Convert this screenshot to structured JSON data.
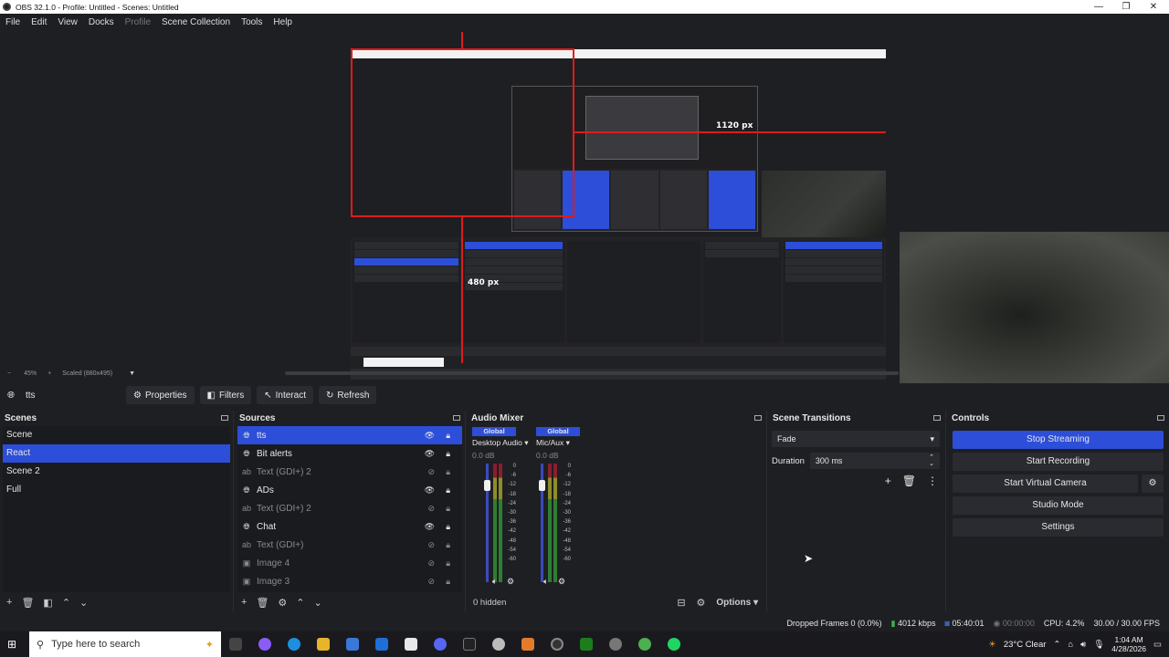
{
  "window": {
    "title": "OBS 32.1.0 - Profile: Untitled - Scenes: Untitled",
    "minimize": "—",
    "restore": "❐",
    "close": "✕"
  },
  "menu": [
    "File",
    "Edit",
    "View",
    "Docks",
    "Profile",
    "Scene Collection",
    "Tools",
    "Help"
  ],
  "preview": {
    "width_label": "1120 px",
    "height_label": "480 px",
    "zoom": "45%",
    "scale_mode": "Scaled (880x495)"
  },
  "source_toolbar": {
    "selected_source": "tts",
    "properties": "Properties",
    "filters": "Filters",
    "interact": "Interact",
    "refresh": "Refresh"
  },
  "scenes": {
    "title": "Scenes",
    "items": [
      "Scene",
      "React",
      "Scene 2",
      "Full"
    ],
    "active": "React"
  },
  "sources": {
    "title": "Sources",
    "items": [
      {
        "name": "tts",
        "icon": "browser-icon",
        "visible": true
      },
      {
        "name": "Bit alerts",
        "icon": "browser-icon",
        "visible": true
      },
      {
        "name": "Text (GDI+) 2",
        "icon": "text-icon",
        "visible": false
      },
      {
        "name": "ADs",
        "icon": "browser-icon",
        "visible": true
      },
      {
        "name": "Text (GDI+) 2",
        "icon": "text-icon",
        "visible": false
      },
      {
        "name": "Chat",
        "icon": "browser-icon",
        "visible": true
      },
      {
        "name": "Text (GDI+)",
        "icon": "text-icon",
        "visible": false
      },
      {
        "name": "Image 4",
        "icon": "image-icon",
        "visible": false
      },
      {
        "name": "Image 3",
        "icon": "image-icon",
        "visible": false
      }
    ]
  },
  "mixer": {
    "title": "Audio Mixer",
    "channels": [
      {
        "scope": "Global",
        "name": "Desktop Audio",
        "db": "0.0 dB"
      },
      {
        "scope": "Global",
        "name": "Mic/Aux",
        "db": "0.0 dB"
      }
    ],
    "scale": [
      "0",
      "-6",
      "-12",
      "-18",
      "-24",
      "-30",
      "-36",
      "-42",
      "-48",
      "-54",
      "-60"
    ],
    "hidden": "0 hidden",
    "options": "Options"
  },
  "transitions": {
    "title": "Scene Transitions",
    "type": "Fade",
    "duration_label": "Duration",
    "duration": "300 ms"
  },
  "controls": {
    "title": "Controls",
    "stop_streaming": "Stop Streaming",
    "start_recording": "Start Recording",
    "start_virtual_camera": "Start Virtual Camera",
    "studio_mode": "Studio Mode",
    "settings": "Settings"
  },
  "status": {
    "dropped": "Dropped Frames 0 (0.0%)",
    "bitrate": "4012 kbps",
    "stream_time": "05:40:01",
    "rec_time": "00:00:00",
    "cpu": "CPU: 4.2%",
    "fps": "30.00 / 30.00 FPS"
  },
  "taskbar": {
    "search_placeholder": "Type here to search",
    "weather": "23°C  Clear",
    "time": "1:04 AM",
    "date": "4/28/2026"
  },
  "colors": {
    "accent": "#2d4ed8",
    "selection_red": "#e01b1b",
    "bg": "#1e1f22"
  }
}
